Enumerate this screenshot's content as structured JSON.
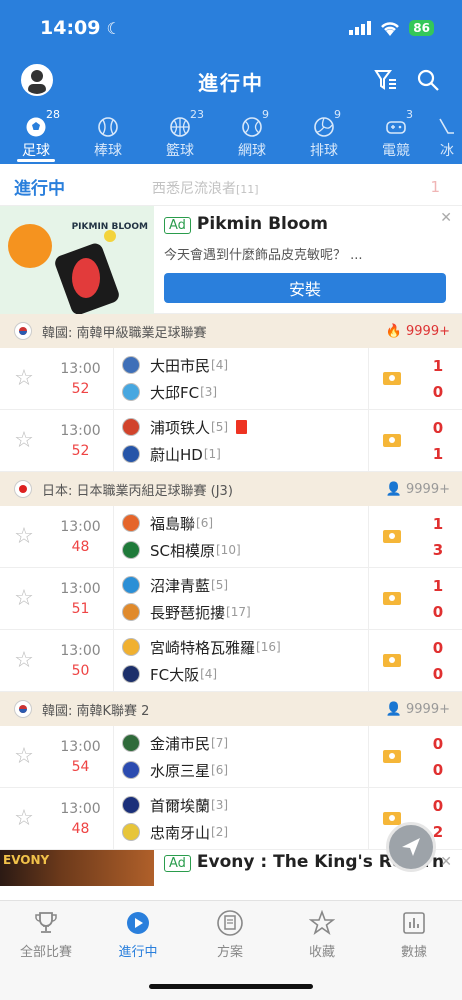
{
  "status": {
    "time": "14:09",
    "battery": "86"
  },
  "header": {
    "title": "進行中"
  },
  "tabs": [
    {
      "label": "足球",
      "count": "28",
      "active": true,
      "icon": "soccer-ball-icon"
    },
    {
      "label": "棒球",
      "count": "",
      "icon": "baseball-icon"
    },
    {
      "label": "籃球",
      "count": "23",
      "icon": "basketball-icon"
    },
    {
      "label": "網球",
      "count": "9",
      "icon": "tennis-icon"
    },
    {
      "label": "排球",
      "count": "9",
      "icon": "volleyball-icon"
    },
    {
      "label": "電競",
      "count": "3",
      "icon": "gamepad-icon"
    },
    {
      "label": "冰",
      "count": "",
      "icon": "hockey-icon"
    }
  ],
  "ghost": {
    "live_label": "進行中",
    "team": "西悉尼流浪者",
    "rank": "[11]",
    "score": "1"
  },
  "ad1": {
    "tag": "Ad",
    "title": "Pikmin Bloom",
    "subtitle": "今天會遇到什麼飾品皮克敏呢？ ...",
    "button": "安裝",
    "brand": "PIKMIN BLOOM",
    "close": "✕"
  },
  "leagues": [
    {
      "name": "韓國: 南韓甲級職業足球聯賽",
      "count": "9999+",
      "matches": [
        {
          "time": "13:00",
          "minute": "52",
          "home": "大田市民",
          "home_rank": "[4]",
          "away": "大邱FC",
          "away_rank": "[3]",
          "home_score": "1",
          "away_score": "0"
        },
        {
          "time": "13:00",
          "minute": "52",
          "home": "浦项铁人",
          "home_rank": "[5]",
          "away": "蔚山HD",
          "away_rank": "[1]",
          "home_score": "0",
          "away_score": "1"
        }
      ]
    },
    {
      "name": "日本: 日本職業丙組足球聯賽 (J3)",
      "count": "9999+",
      "matches": [
        {
          "time": "13:00",
          "minute": "48",
          "home": "福島聯",
          "home_rank": "[6]",
          "away": "SC相模原",
          "away_rank": "[10]",
          "home_score": "1",
          "away_score": "3"
        },
        {
          "time": "13:00",
          "minute": "51",
          "home": "沼津青藍",
          "home_rank": "[5]",
          "away": "長野琶扼摟",
          "away_rank": "[17]",
          "home_score": "1",
          "away_score": "0"
        },
        {
          "time": "13:00",
          "minute": "50",
          "home": "宮崎特格瓦雅羅",
          "home_rank": "[16]",
          "away": "FC大阪",
          "away_rank": "[4]",
          "home_score": "0",
          "away_score": "0"
        }
      ]
    },
    {
      "name": "韓國: 南韓K聯賽 2",
      "count": "9999+",
      "matches": [
        {
          "time": "13:00",
          "minute": "54",
          "home": "金浦市民",
          "home_rank": "[7]",
          "away": "水原三星",
          "away_rank": "[6]",
          "home_score": "0",
          "away_score": "0"
        },
        {
          "time": "13:00",
          "minute": "48",
          "home": "首爾埃蘭",
          "home_rank": "[3]",
          "away": "忠南牙山",
          "away_rank": "[2]",
          "home_score": "0",
          "away_score": "2"
        }
      ]
    }
  ],
  "ad2": {
    "tag": "Ad",
    "title": "Evony : The King's Return",
    "brand": "EVONY",
    "close": "✕"
  },
  "bottom_nav": [
    {
      "label": "全部比賽",
      "icon": "trophy-icon"
    },
    {
      "label": "進行中",
      "icon": "play-icon",
      "active": true
    },
    {
      "label": "方案",
      "icon": "document-icon"
    },
    {
      "label": "收藏",
      "icon": "star-icon"
    },
    {
      "label": "數據",
      "icon": "bar-chart-icon"
    }
  ],
  "colors": {
    "primary": "#2a7fdc",
    "score": "#e03030",
    "league_bg": "#f4ecdf",
    "battery": "#34c759"
  }
}
